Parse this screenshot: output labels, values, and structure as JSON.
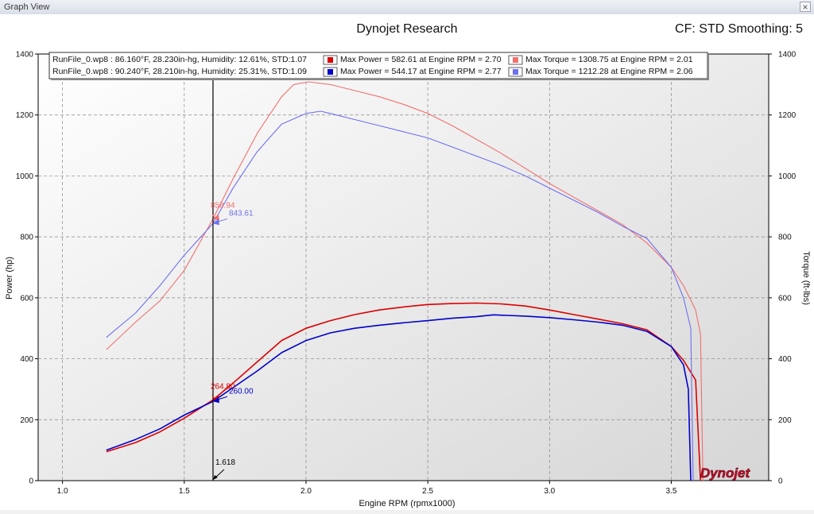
{
  "window": {
    "title": "Graph View",
    "close_glyph": "×"
  },
  "header": {
    "title": "Dynojet Research",
    "cf_label": "CF: STD Smoothing: 5"
  },
  "logo_text": "Dynojet",
  "colors": {
    "run1_power": "#dd0000",
    "run1_torque": "#f07070",
    "run2_power": "#0000cc",
    "run2_torque": "#7070ee",
    "cursor": "#000000"
  },
  "legend": {
    "rows": [
      {
        "file": "RunFile_0.wp8 : 86.160°F, 28.230in-hg, Humidity: 12.61%, STD:1.07",
        "power": "Max Power = 582.61 at Engine RPM = 2.70",
        "torque": "Max Torque = 1308.75 at Engine RPM = 2.01"
      },
      {
        "file": "RunFile_0.wp8 : 90.240°F, 28.210in-hg, Humidity: 25.31%, STD:1.09",
        "power": "Max Power = 544.17 at Engine RPM = 2.77",
        "torque": "Max Torque = 1212.28 at Engine RPM = 2.06"
      }
    ]
  },
  "cursor": {
    "x": 1.618,
    "label": "1.618",
    "values": [
      {
        "y": 858.94,
        "label": "858.94",
        "axis": "right",
        "color": "#f07070"
      },
      {
        "y": 843.61,
        "label": "843.61",
        "axis": "right",
        "color": "#7070ee"
      },
      {
        "y": 264.8,
        "label": "264.80",
        "axis": "left",
        "color": "#dd0000"
      },
      {
        "y": 260.0,
        "label": "260.00",
        "axis": "left",
        "color": "#0000cc"
      }
    ]
  },
  "chart_data": {
    "type": "line",
    "xlabel": "Engine RPM (rpmx1000)",
    "ylabel": "Power (hp)",
    "y2label": "Torque (ft-lbs)",
    "xlim": [
      0.9,
      3.9
    ],
    "ylim": [
      0,
      1400
    ],
    "y2lim": [
      0,
      1400
    ],
    "x_ticks": [
      1.0,
      1.5,
      2.0,
      2.5,
      3.0,
      3.5
    ],
    "x_tick_labels": [
      "1.0",
      "1.5",
      "2.0",
      "2.5",
      "3.0",
      "3.5"
    ],
    "y_ticks": [
      0,
      200,
      400,
      600,
      800,
      1000,
      1200,
      1400
    ],
    "y_tick_labels": [
      "0",
      "200",
      "400",
      "600",
      "800",
      "1000",
      "1200",
      "1400"
    ],
    "grid": true,
    "series": [
      {
        "key": "run1_power",
        "axis": "left",
        "x": [
          1.18,
          1.3,
          1.4,
          1.5,
          1.618,
          1.7,
          1.8,
          1.9,
          2.0,
          2.1,
          2.2,
          2.3,
          2.4,
          2.5,
          2.6,
          2.7,
          2.8,
          2.9,
          3.0,
          3.1,
          3.2,
          3.3,
          3.4,
          3.5,
          3.55,
          3.6,
          3.62
        ],
        "y": [
          95,
          125,
          160,
          205,
          264.8,
          320,
          390,
          460,
          500,
          525,
          545,
          560,
          570,
          578,
          581,
          582.6,
          580,
          573,
          560,
          545,
          530,
          515,
          495,
          440,
          395,
          330,
          0
        ]
      },
      {
        "key": "run2_power",
        "axis": "left",
        "x": [
          1.18,
          1.3,
          1.4,
          1.5,
          1.618,
          1.7,
          1.8,
          1.9,
          2.0,
          2.1,
          2.2,
          2.3,
          2.4,
          2.5,
          2.6,
          2.7,
          2.77,
          2.9,
          3.0,
          3.1,
          3.2,
          3.3,
          3.4,
          3.5,
          3.55,
          3.57,
          3.58
        ],
        "y": [
          100,
          135,
          170,
          215,
          260,
          305,
          360,
          420,
          460,
          485,
          500,
          510,
          518,
          525,
          533,
          538,
          544.2,
          540,
          535,
          528,
          520,
          510,
          490,
          440,
          380,
          300,
          0
        ]
      },
      {
        "key": "run1_torque",
        "axis": "right",
        "x": [
          1.18,
          1.3,
          1.4,
          1.5,
          1.618,
          1.7,
          1.8,
          1.9,
          1.95,
          2.01,
          2.1,
          2.2,
          2.3,
          2.4,
          2.5,
          2.6,
          2.7,
          2.8,
          2.9,
          3.0,
          3.1,
          3.2,
          3.3,
          3.4,
          3.5,
          3.55,
          3.6,
          3.62,
          3.63
        ],
        "y": [
          430,
          520,
          590,
          690,
          858.9,
          990,
          1140,
          1260,
          1300,
          1308.8,
          1300,
          1280,
          1260,
          1235,
          1205,
          1165,
          1120,
          1075,
          1025,
          975,
          930,
          885,
          840,
          780,
          700,
          640,
          560,
          480,
          0
        ]
      },
      {
        "key": "run2_torque",
        "axis": "right",
        "x": [
          1.18,
          1.3,
          1.4,
          1.5,
          1.618,
          1.7,
          1.8,
          1.9,
          2.0,
          2.06,
          2.1,
          2.2,
          2.3,
          2.4,
          2.5,
          2.6,
          2.7,
          2.8,
          2.9,
          3.0,
          3.1,
          3.2,
          3.3,
          3.4,
          3.5,
          3.55,
          3.58,
          3.59
        ],
        "y": [
          470,
          550,
          640,
          740,
          843.6,
          960,
          1080,
          1170,
          1205,
          1212.3,
          1205,
          1185,
          1165,
          1145,
          1125,
          1095,
          1065,
          1035,
          1000,
          960,
          920,
          880,
          835,
          795,
          700,
          600,
          500,
          0
        ]
      }
    ]
  }
}
